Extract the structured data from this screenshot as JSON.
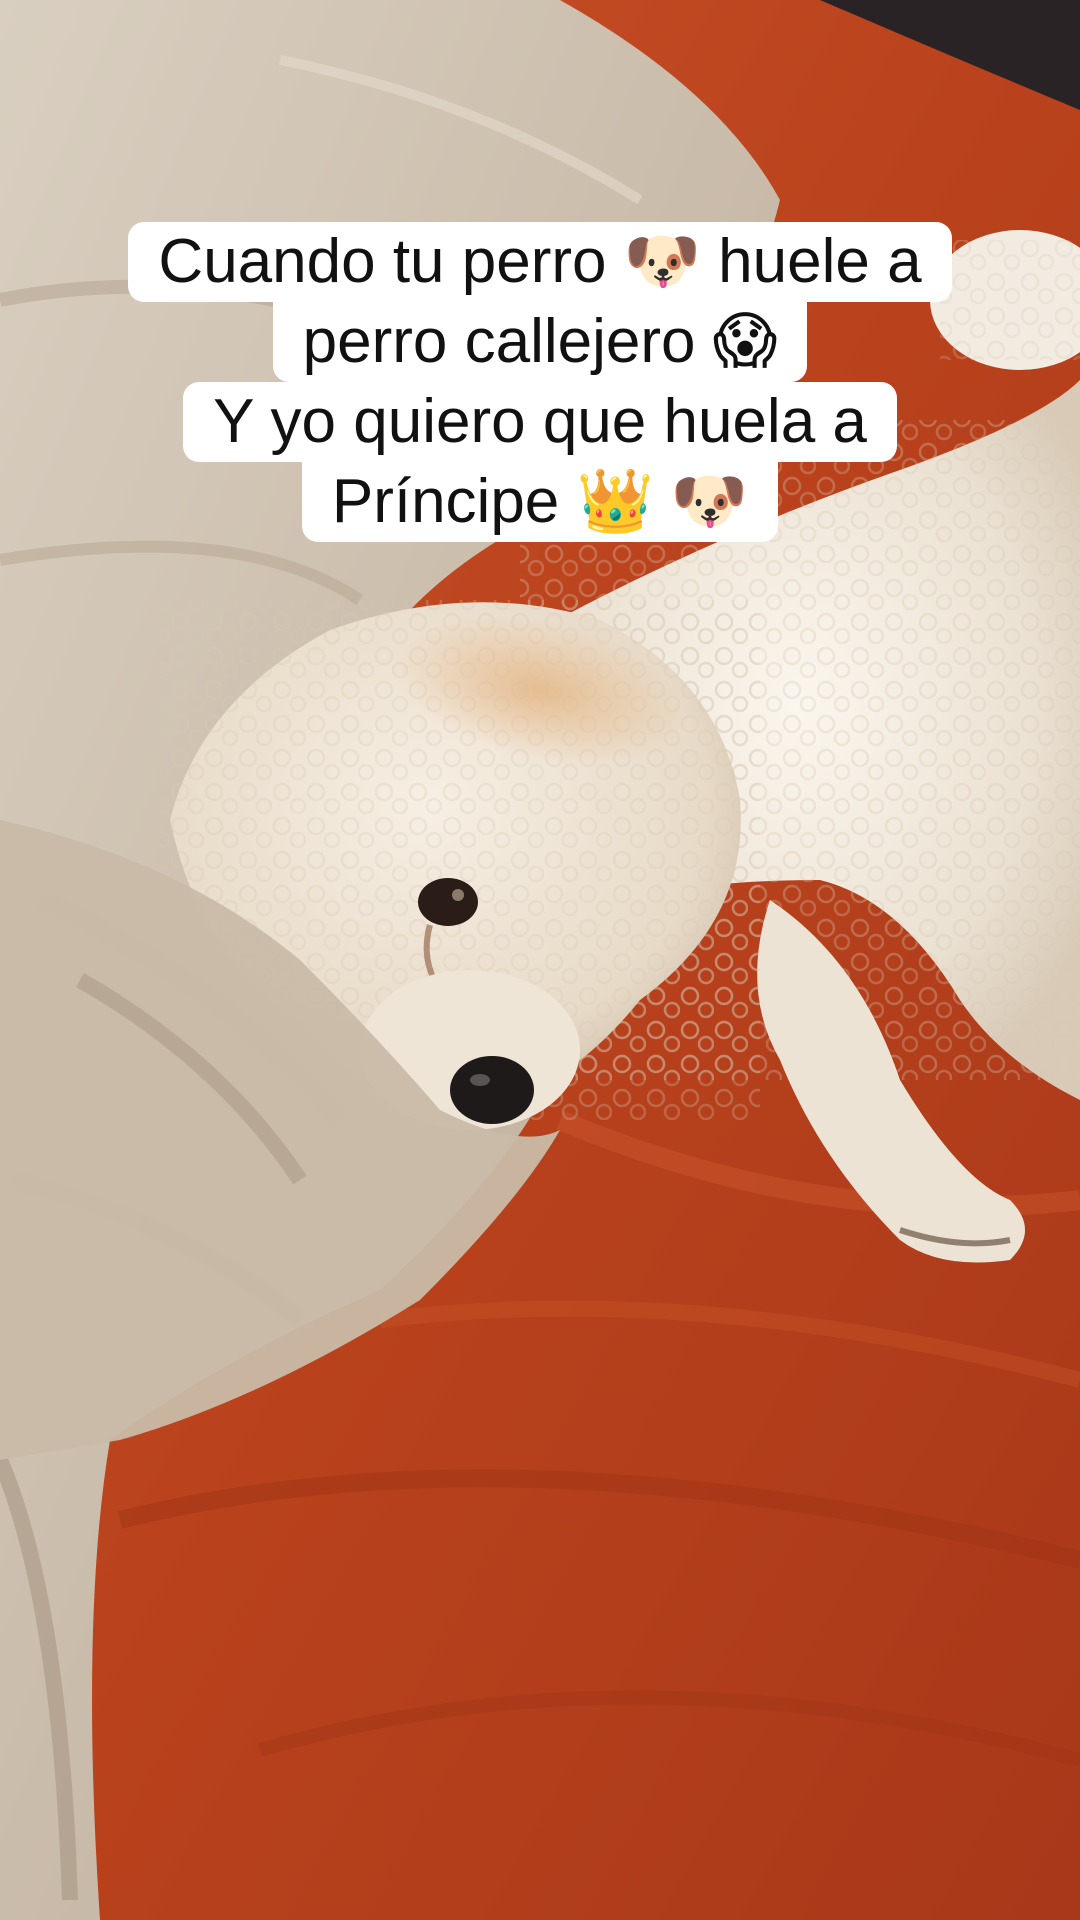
{
  "caption": {
    "line1": "Cuando tu perro 🐶 huele a",
    "line2": "perro callejero 😱",
    "line3": "Y yo quiero que huela a",
    "line4": "Príncipe 👑 🐶"
  },
  "scene": {
    "subject": "white curly-haired dog lying on a bed",
    "colors": {
      "sheet": "#c2471f",
      "blanket": "#cdbfae",
      "dog_fur": "#efe6d8",
      "caption_bg": "#ffffff",
      "caption_text": "#111111"
    }
  }
}
